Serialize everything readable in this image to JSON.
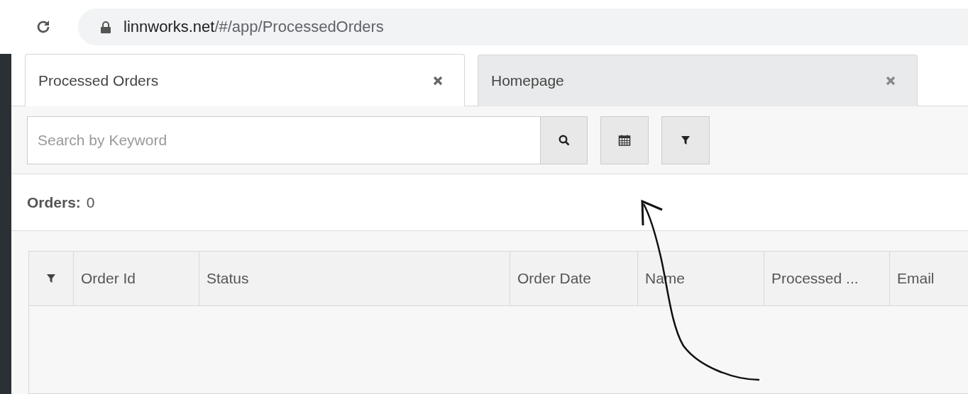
{
  "browser": {
    "url_host": "linnworks.net",
    "url_path": "/#/app/ProcessedOrders"
  },
  "tabs": [
    {
      "label": "Processed Orders",
      "selected": true
    },
    {
      "label": "Homepage",
      "selected": false
    }
  ],
  "search": {
    "placeholder": "Search by Keyword"
  },
  "orders": {
    "label": "Orders:",
    "count": "0"
  },
  "table": {
    "columns": [
      "Order Id",
      "Status",
      "Order Date",
      "Name",
      "Processed ...",
      "Email"
    ]
  }
}
